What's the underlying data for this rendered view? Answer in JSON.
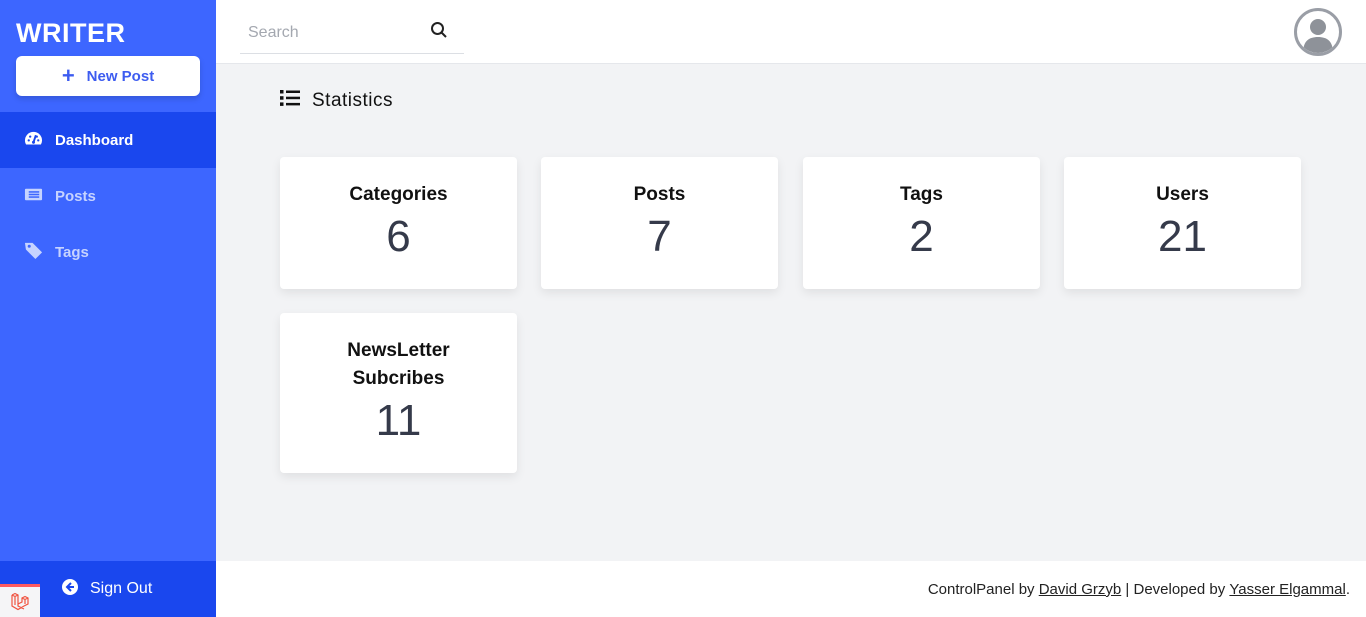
{
  "sidebar": {
    "brand": "WRITER",
    "new_post_label": "New Post",
    "items": [
      {
        "label": "Dashboard",
        "icon": "tachometer-icon",
        "active": true
      },
      {
        "label": "Posts",
        "icon": "newspaper-icon",
        "active": false
      },
      {
        "label": "Tags",
        "icon": "tag-icon",
        "active": false
      }
    ],
    "sign_out_label": "Sign Out"
  },
  "header": {
    "search_placeholder": "Search",
    "search_value": ""
  },
  "main": {
    "section_title": "Statistics",
    "stats": [
      {
        "label": "Categories",
        "value": "6"
      },
      {
        "label": "Posts",
        "value": "7"
      },
      {
        "label": "Tags",
        "value": "2"
      },
      {
        "label": "Users",
        "value": "21"
      },
      {
        "label": "NewsLetter Subcribes",
        "value": "11"
      }
    ]
  },
  "footer": {
    "prefix": "ControlPanel by",
    "author_link": "David Grzyb",
    "separator": "| Developed by",
    "developer_link": "Yasser Elgammal",
    "suffix": "."
  },
  "colors": {
    "sidebar": "#3d66ff",
    "sidebar_active": "#1a47ee",
    "accent": "#3d5cf0",
    "background": "#f2f3f5"
  }
}
